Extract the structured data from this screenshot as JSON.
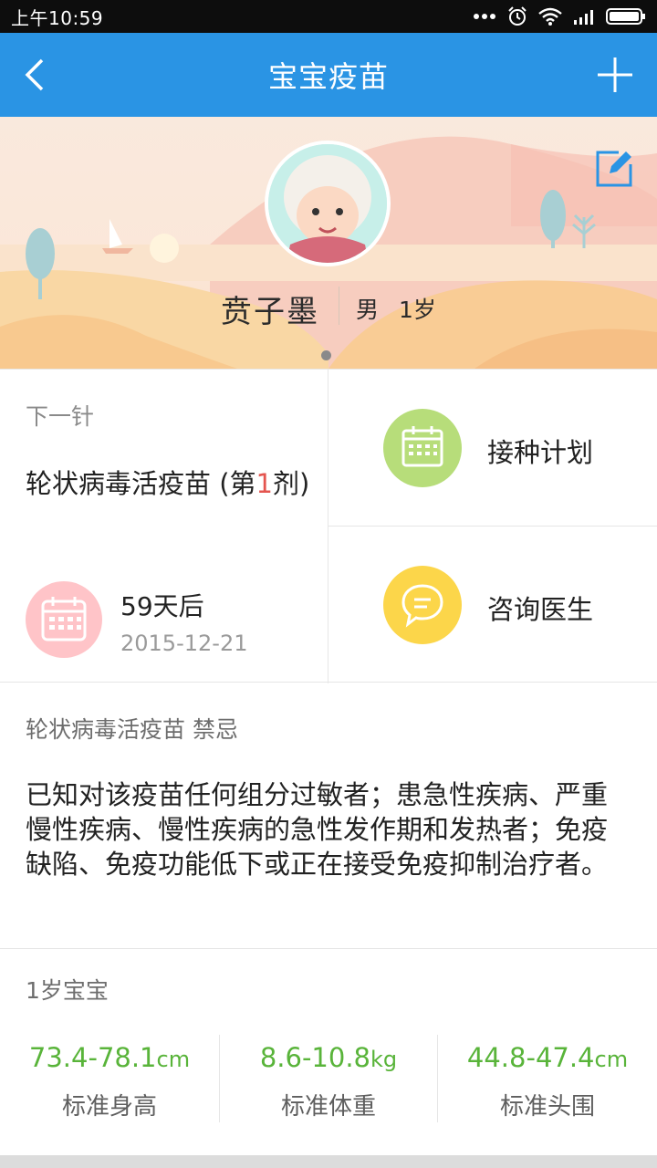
{
  "status_bar": {
    "time": "上午10:59",
    "icons": [
      "more-dots-icon",
      "alarm-icon",
      "wifi-icon",
      "signal-icon",
      "battery-icon"
    ]
  },
  "app_bar": {
    "title": "宝宝疫苗",
    "back_icon": "back-chevron-icon",
    "add_icon": "plus-icon",
    "color": "#2a94e4"
  },
  "profile": {
    "name": "贲子墨",
    "gender": "男",
    "age": "1岁",
    "edit_icon": "edit-icon",
    "carousel_pages": 1
  },
  "next_shot": {
    "label": "下一针",
    "vaccine_prefix": "轮状病毒活疫苗 (第",
    "dose_number": "1",
    "vaccine_suffix": "剂)",
    "days_until": "59天后",
    "date": "2015-12-21",
    "icon": "calendar-icon"
  },
  "actions": [
    {
      "label": "接种计划",
      "icon": "schedule-calendar-icon",
      "color": "#b7dd7a"
    },
    {
      "label": "咨询医生",
      "icon": "chat-bubble-icon",
      "color": "#fcd64a"
    }
  ],
  "contraindication": {
    "title": "轮状病毒活疫苗 禁忌",
    "body": "已知对该疫苗任何组分过敏者；患急性疾病、严重慢性疾病、慢性疾病的急性发作期和发热者；免疫缺陷、免疫功能低下或正在接受免疫抑制治疗者。"
  },
  "growth": {
    "title": "1岁宝宝",
    "accent": "#59b43a",
    "stats": [
      {
        "value": "73.4-78.1",
        "unit": "cm",
        "label": "标准身高"
      },
      {
        "value": "8.6-10.8",
        "unit": "kg",
        "label": "标准体重"
      },
      {
        "value": "44.8-47.4",
        "unit": "cm",
        "label": "标准头围"
      }
    ]
  }
}
